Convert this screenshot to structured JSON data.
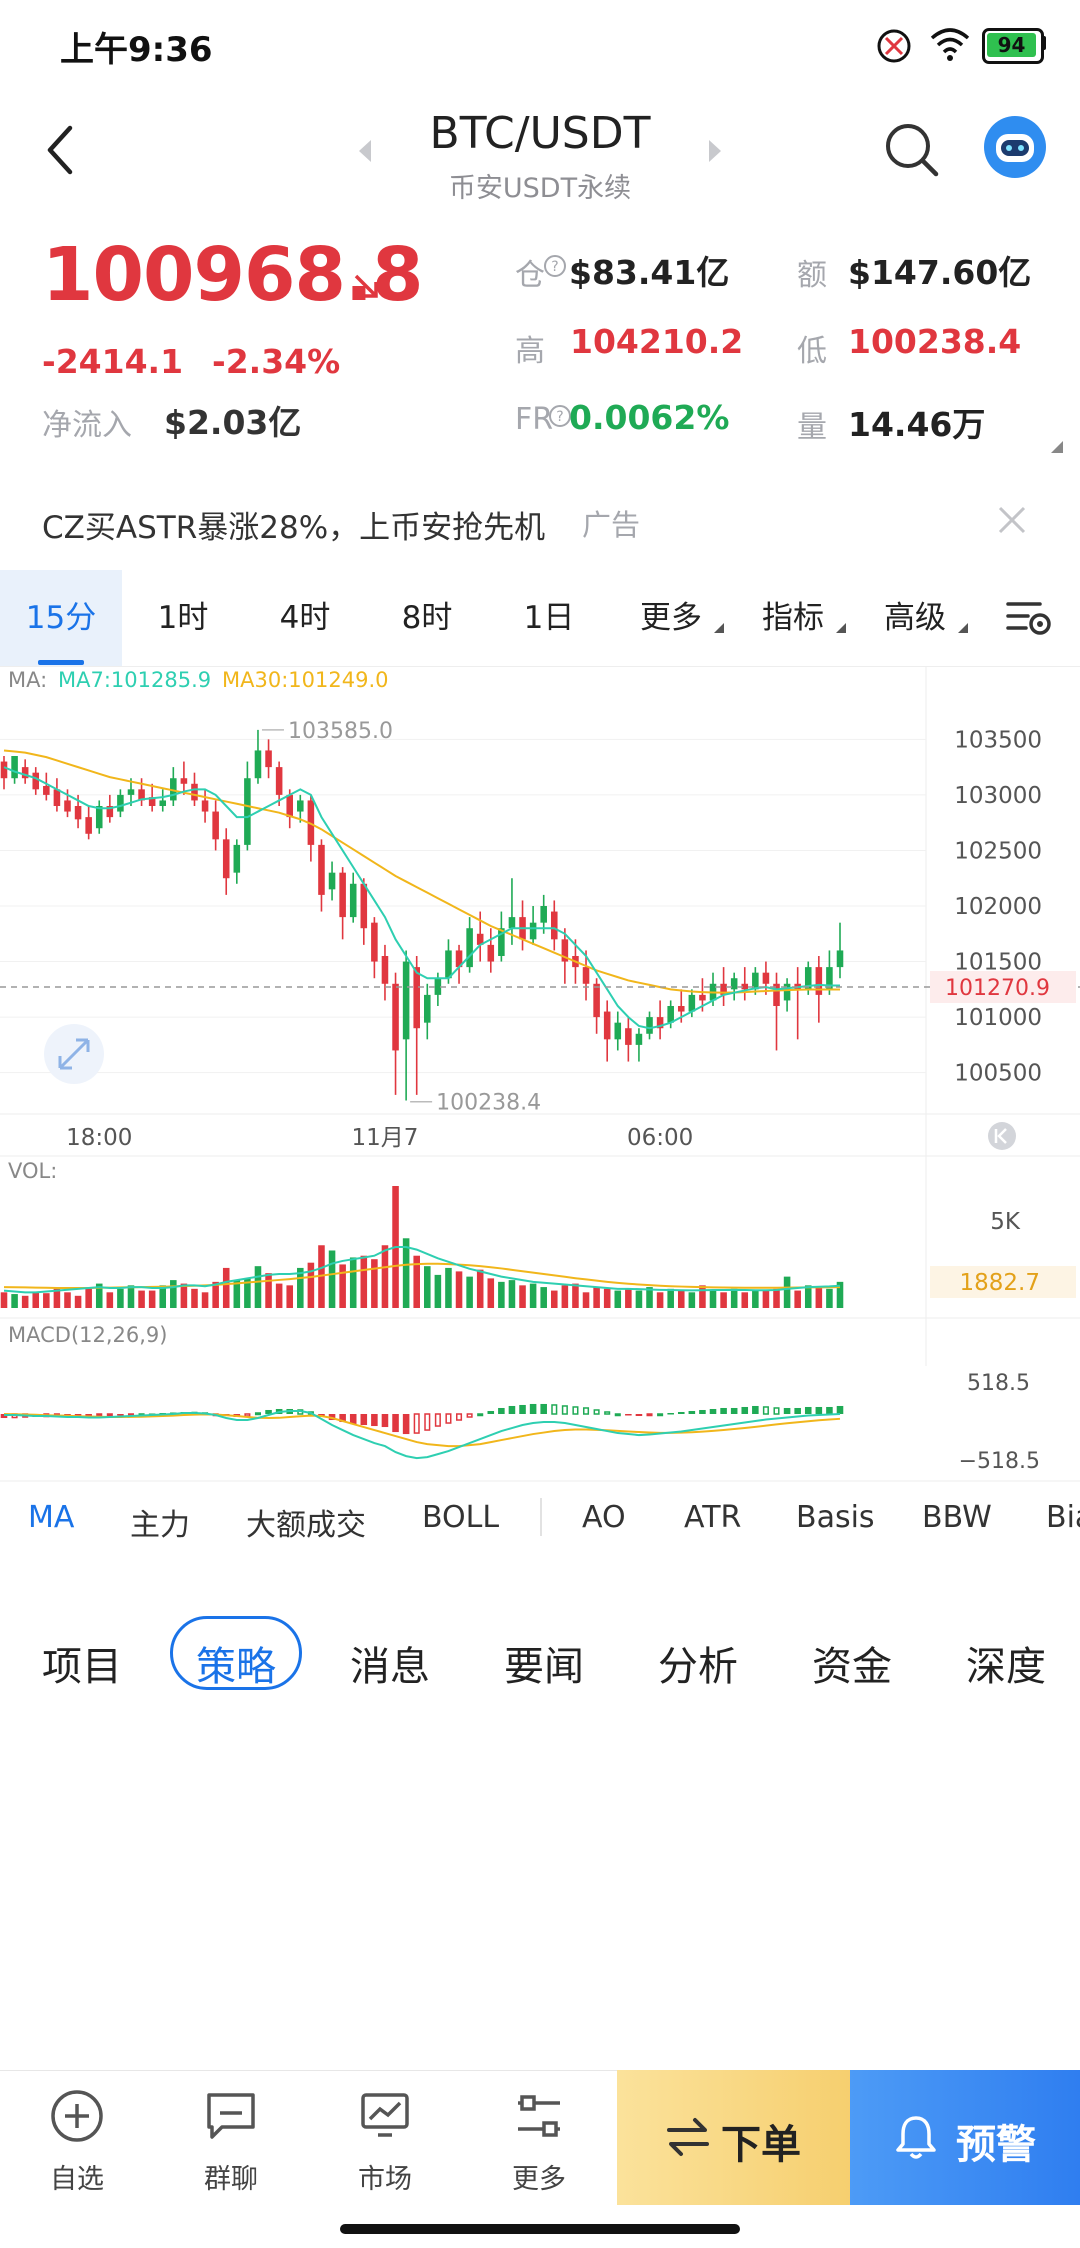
{
  "status": {
    "time": "上午9:36",
    "battery": "94"
  },
  "header": {
    "pair": "BTC/USDT",
    "exchange": "币安USDT永续"
  },
  "quote": {
    "last_price": "100968.8",
    "change": "-2414.1",
    "change_pct": "-2.34%",
    "net_inflow_label": "净流入",
    "net_inflow": "$2.03亿",
    "oi_label": "仓",
    "oi_value": "$83.41亿",
    "turnover_label": "额",
    "turnover_value": "$147.60亿",
    "high_label": "高",
    "high_value": "104210.2",
    "low_label": "低",
    "low_value": "100238.4",
    "fr_label": "FR",
    "fr_value": "0.0062%",
    "volume_label": "量",
    "volume_value": "14.46万"
  },
  "ad": {
    "text": "CZ买ASTR暴涨28%，上币安抢先机",
    "tag": "广告"
  },
  "interval_tabs": [
    "15分",
    "1时",
    "4时",
    "8时",
    "1日",
    "更多",
    "指标",
    "高级"
  ],
  "chart_data": [
    {
      "type": "candlestick",
      "legend": {
        "label": "MA:",
        "ma7": "MA7:101285.9",
        "ma30": "MA30:101249.0"
      },
      "y_ticks": [
        "103500",
        "103000",
        "102500",
        "102000",
        "101500",
        "101000",
        "100500"
      ],
      "ylim": [
        100200,
        103800
      ],
      "x_ticks": [
        "18:00",
        "11月7",
        "06:00"
      ],
      "last_price_tag": "101270.9",
      "last_price": 101270.9,
      "high_marker": "103585.0",
      "high": 103585.0,
      "low_marker": "100238.4",
      "low": 100238.4,
      "candles": [
        [
          103300,
          103350,
          103150,
          103050
        ],
        [
          103150,
          103250,
          103350,
          103100
        ],
        [
          103250,
          103320,
          103150,
          103100
        ],
        [
          103200,
          103250,
          103050,
          103000
        ],
        [
          103080,
          103200,
          103000,
          102950
        ],
        [
          103050,
          103150,
          102900,
          102850
        ],
        [
          102950,
          103050,
          102850,
          102800
        ],
        [
          102900,
          103000,
          102780,
          102700
        ],
        [
          102800,
          102900,
          102650,
          102600
        ],
        [
          102700,
          102950,
          102900,
          102650
        ],
        [
          102900,
          103000,
          102800,
          102750
        ],
        [
          102850,
          103050,
          103000,
          102800
        ],
        [
          103000,
          103150,
          103050,
          102900
        ],
        [
          103050,
          103150,
          102950,
          102900
        ],
        [
          102980,
          103100,
          102900,
          102850
        ],
        [
          102900,
          103050,
          102950,
          102850
        ],
        [
          102950,
          103250,
          103150,
          102900
        ],
        [
          103150,
          103300,
          103100,
          103000
        ],
        [
          103100,
          103200,
          102950,
          102900
        ],
        [
          102950,
          103050,
          102850,
          102750
        ],
        [
          102850,
          102950,
          102600,
          102500
        ],
        [
          102600,
          102700,
          102250,
          102100
        ],
        [
          102300,
          102600,
          102550,
          102200
        ],
        [
          102550,
          103300,
          103150,
          102500
        ],
        [
          103150,
          103585,
          103400,
          103100
        ],
        [
          103400,
          103500,
          103250,
          103150
        ],
        [
          103250,
          103300,
          103000,
          102900
        ],
        [
          103000,
          103050,
          102800,
          102700
        ],
        [
          102850,
          103000,
          102950,
          102750
        ],
        [
          102950,
          103000,
          102550,
          102400
        ],
        [
          102550,
          102600,
          102100,
          101950
        ],
        [
          102150,
          102400,
          102300,
          102050
        ],
        [
          102300,
          102350,
          101900,
          101700
        ],
        [
          101900,
          102300,
          102200,
          101850
        ],
        [
          102200,
          102250,
          101800,
          101650
        ],
        [
          101850,
          101900,
          101500,
          101350
        ],
        [
          101550,
          101650,
          101300,
          101150
        ],
        [
          101300,
          101400,
          100700,
          100300
        ],
        [
          100800,
          101600,
          101500,
          100250
        ],
        [
          101450,
          101550,
          100900,
          100300
        ],
        [
          100950,
          101300,
          101200,
          100800
        ],
        [
          101200,
          101400,
          101350,
          101100
        ],
        [
          101350,
          101700,
          101600,
          101300
        ],
        [
          101600,
          101650,
          101450,
          101300
        ],
        [
          101450,
          101900,
          101800,
          101400
        ],
        [
          101750,
          101950,
          101650,
          101500
        ],
        [
          101650,
          101800,
          101500,
          101400
        ],
        [
          101550,
          101950,
          101800,
          101500
        ],
        [
          101800,
          102250,
          101900,
          101650
        ],
        [
          101900,
          102050,
          101700,
          101600
        ],
        [
          101700,
          102000,
          101850,
          101650
        ],
        [
          101850,
          102100,
          102000,
          101750
        ],
        [
          101950,
          102050,
          101700,
          101600
        ],
        [
          101700,
          101800,
          101500,
          101300
        ],
        [
          101550,
          101700,
          101450,
          101300
        ],
        [
          101450,
          101600,
          101300,
          101150
        ],
        [
          101300,
          101350,
          101000,
          100850
        ],
        [
          101050,
          101150,
          100800,
          100600
        ],
        [
          100800,
          101050,
          100950,
          100700
        ],
        [
          100900,
          101000,
          100750,
          100600
        ],
        [
          100750,
          100900,
          100850,
          100600
        ],
        [
          100850,
          101050,
          101000,
          100800
        ],
        [
          101000,
          101150,
          100900,
          100800
        ],
        [
          100950,
          101150,
          101100,
          100900
        ],
        [
          101100,
          101250,
          101050,
          100950
        ],
        [
          101050,
          101250,
          101200,
          101000
        ],
        [
          101200,
          101350,
          101150,
          101050
        ],
        [
          101150,
          101400,
          101300,
          101100
        ],
        [
          101300,
          101450,
          101200,
          101100
        ],
        [
          101250,
          101400,
          101350,
          101150
        ],
        [
          101300,
          101450,
          101250,
          101150
        ],
        [
          101250,
          101450,
          101400,
          101200
        ],
        [
          101400,
          101500,
          101300,
          101200
        ],
        [
          101300,
          101400,
          101100,
          100700
        ],
        [
          101150,
          101350,
          101300,
          101050
        ],
        [
          101300,
          101450,
          101250,
          100800
        ],
        [
          101250,
          101500,
          101450,
          101200
        ],
        [
          101450,
          101550,
          101200,
          100950
        ],
        [
          101250,
          101600,
          101450,
          101200
        ],
        [
          101450,
          101850,
          101600,
          101350
        ]
      ],
      "ma7": [
        103250,
        103210,
        103180,
        103150,
        103100,
        103050,
        103000,
        102950,
        102900,
        102880,
        102880,
        102900,
        102930,
        102960,
        102970,
        102980,
        103000,
        103030,
        103050,
        103050,
        103000,
        102900,
        102800,
        102800,
        102850,
        102900,
        102950,
        103000,
        103050,
        103000,
        102800,
        102650,
        102500,
        102350,
        102200,
        102050,
        101900,
        101700,
        101550,
        101400,
        101350,
        101350,
        101350,
        101450,
        101550,
        101650,
        101700,
        101750,
        101800,
        101800,
        101800,
        101800,
        101800,
        101750,
        101650,
        101550,
        101400,
        101250,
        101100,
        101000,
        100920,
        100900,
        100920,
        100950,
        101000,
        101050,
        101100,
        101150,
        101200,
        101220,
        101240,
        101260,
        101270,
        101250,
        101260,
        101270,
        101280,
        101290,
        101285,
        101285
      ],
      "ma30": [
        103400,
        103390,
        103380,
        103360,
        103340,
        103310,
        103280,
        103250,
        103220,
        103190,
        103160,
        103140,
        103120,
        103100,
        103080,
        103060,
        103040,
        103020,
        103000,
        102980,
        102960,
        102940,
        102920,
        102900,
        102880,
        102860,
        102840,
        102810,
        102780,
        102740,
        102690,
        102630,
        102570,
        102510,
        102450,
        102390,
        102330,
        102270,
        102220,
        102170,
        102120,
        102070,
        102020,
        101970,
        101920,
        101870,
        101820,
        101780,
        101740,
        101700,
        101660,
        101620,
        101580,
        101540,
        101500,
        101460,
        101420,
        101390,
        101360,
        101330,
        101310,
        101290,
        101270,
        101250,
        101240,
        101230,
        101225,
        101222,
        101220,
        101222,
        101225,
        101230,
        101235,
        101240,
        101243,
        101246,
        101248,
        101249,
        101249,
        101249
      ]
    },
    {
      "type": "bar",
      "label": "VOL:",
      "y_ticks": [
        "5K"
      ],
      "ylim": [
        0,
        7000
      ],
      "last_volume_tag": "1882.7",
      "values": [
        900,
        800,
        700,
        900,
        850,
        1100,
        900,
        700,
        1200,
        1400,
        900,
        1100,
        1300,
        1000,
        1000,
        1300,
        1600,
        1400,
        1100,
        900,
        1500,
        2300,
        1600,
        1700,
        2400,
        2000,
        1400,
        1300,
        2300,
        2600,
        3600,
        3300,
        2500,
        2900,
        3000,
        2800,
        3600,
        7000,
        4000,
        3000,
        2400,
        1900,
        2300,
        2100,
        1800,
        2200,
        1700,
        1500,
        1600,
        1300,
        1400,
        1200,
        1000,
        1300,
        1400,
        900,
        1200,
        1100,
        1000,
        1100,
        1000,
        1200,
        900,
        1100,
        1000,
        900,
        1300,
        1000,
        900,
        1100,
        900,
        1000,
        1000,
        1100,
        1800,
        1000,
        1300,
        1200,
        1100,
        1500
      ],
      "ma_a": [
        1000,
        950,
        900,
        900,
        950,
        1000,
        1050,
        1100,
        1150,
        1200,
        1150,
        1150,
        1200,
        1200,
        1150,
        1150,
        1200,
        1300,
        1300,
        1250,
        1350,
        1500,
        1600,
        1700,
        1800,
        1900,
        1950,
        1950,
        2000,
        2100,
        2300,
        2550,
        2700,
        2800,
        2900,
        3000,
        3300,
        3500,
        3500,
        3350,
        3100,
        2850,
        2650,
        2450,
        2250,
        2100,
        1950,
        1800,
        1700,
        1600,
        1500,
        1450,
        1400,
        1350,
        1300,
        1250,
        1200,
        1150,
        1100,
        1100,
        1080,
        1060,
        1040,
        1030,
        1020,
        1010,
        1020,
        1030,
        1030,
        1040,
        1030,
        1020,
        1020,
        1030,
        1100,
        1150,
        1200,
        1220,
        1240,
        1280
      ],
      "ma_b": [
        1200,
        1190,
        1180,
        1170,
        1160,
        1150,
        1150,
        1150,
        1150,
        1160,
        1170,
        1180,
        1190,
        1200,
        1210,
        1220,
        1240,
        1260,
        1280,
        1300,
        1330,
        1370,
        1410,
        1460,
        1510,
        1560,
        1610,
        1660,
        1720,
        1780,
        1860,
        1940,
        2020,
        2100,
        2180,
        2260,
        2340,
        2420,
        2480,
        2520,
        2540,
        2540,
        2520,
        2490,
        2450,
        2400,
        2340,
        2270,
        2190,
        2110,
        2030,
        1950,
        1870,
        1790,
        1710,
        1640,
        1570,
        1500,
        1440,
        1390,
        1350,
        1310,
        1280,
        1250,
        1230,
        1210,
        1195,
        1185,
        1175,
        1170,
        1165,
        1160,
        1160,
        1165,
        1170,
        1175,
        1180,
        1185,
        1190,
        1195
      ]
    },
    {
      "type": "bar",
      "label": "MACD(12,26,9)",
      "y_ticks": [
        "518.5",
        "−518.5"
      ],
      "ylim": [
        -518.5,
        518.5
      ],
      "hist": [
        -40,
        -35,
        -30,
        -30,
        -25,
        -20,
        -20,
        -20,
        -20,
        -15,
        -10,
        -10,
        -5,
        0,
        5,
        10,
        15,
        20,
        15,
        10,
        -5,
        -20,
        -30,
        -20,
        10,
        40,
        50,
        50,
        40,
        20,
        -30,
        -60,
        -80,
        -100,
        -110,
        -120,
        -130,
        -180,
        -200,
        -190,
        -160,
        -120,
        -90,
        -60,
        -30,
        0,
        30,
        60,
        80,
        90,
        100,
        100,
        90,
        80,
        70,
        60,
        40,
        20,
        0,
        -10,
        -20,
        -10,
        0,
        10,
        20,
        30,
        40,
        50,
        60,
        60,
        70,
        80,
        70,
        60,
        60,
        60,
        70,
        70,
        70,
        80
      ],
      "dif": [
        -10,
        -10,
        -15,
        -20,
        -20,
        -25,
        -30,
        -30,
        -35,
        -35,
        -30,
        -25,
        -20,
        -15,
        -10,
        -5,
        0,
        10,
        10,
        5,
        -10,
        -40,
        -60,
        -60,
        -40,
        -10,
        20,
        30,
        30,
        10,
        -50,
        -110,
        -160,
        -210,
        -250,
        -290,
        -320,
        -380,
        -420,
        -440,
        -430,
        -400,
        -370,
        -330,
        -290,
        -250,
        -210,
        -170,
        -140,
        -110,
        -90,
        -80,
        -80,
        -90,
        -110,
        -130,
        -150,
        -170,
        -190,
        -200,
        -210,
        -205,
        -195,
        -185,
        -175,
        -160,
        -145,
        -130,
        -115,
        -100,
        -85,
        -70,
        -55,
        -45,
        -35,
        -25,
        -15,
        -10,
        -5,
        0
      ],
      "dea": [
        0,
        -2,
        -5,
        -8,
        -12,
        -15,
        -18,
        -22,
        -25,
        -28,
        -30,
        -30,
        -29,
        -27,
        -24,
        -20,
        -16,
        -10,
        -6,
        -4,
        -5,
        -12,
        -20,
        -30,
        -38,
        -40,
        -38,
        -30,
        -22,
        -16,
        -20,
        -40,
        -70,
        -100,
        -130,
        -160,
        -190,
        -220,
        -250,
        -280,
        -300,
        -310,
        -320,
        -320,
        -310,
        -300,
        -280,
        -260,
        -240,
        -220,
        -200,
        -185,
        -170,
        -160,
        -155,
        -155,
        -158,
        -162,
        -168,
        -175,
        -180,
        -185,
        -188,
        -188,
        -186,
        -182,
        -176,
        -168,
        -160,
        -150,
        -140,
        -128,
        -116,
        -104,
        -92,
        -82,
        -72,
        -62,
        -55,
        -48
      ]
    }
  ],
  "indicators": [
    "MA",
    "主力",
    "大额成交",
    "BOLL",
    "AO",
    "ATR",
    "Basis",
    "BBW",
    "Bia"
  ],
  "content_tabs": [
    "项目",
    "策略",
    "消息",
    "要闻",
    "分析",
    "资金",
    "深度"
  ],
  "bottom_nav": [
    {
      "label": "自选",
      "icon": "add-favorite-icon"
    },
    {
      "label": "群聊",
      "icon": "chat-icon"
    },
    {
      "label": "市场",
      "icon": "market-icon"
    },
    {
      "label": "更多",
      "icon": "more-settings-icon"
    }
  ],
  "actions": {
    "order": "下单",
    "alert": "预警"
  },
  "colors": {
    "up": "#1faa55",
    "down": "#e0373f",
    "accent": "#1a73e8",
    "ma7": "#2ecfb1",
    "ma30": "#f1b61b"
  }
}
